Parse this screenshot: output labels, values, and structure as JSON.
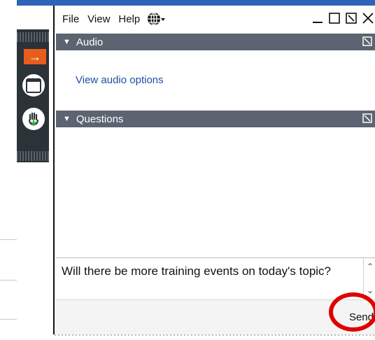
{
  "menubar": {
    "items": [
      "File",
      "View",
      "Help"
    ],
    "language_icon": "globe-icon",
    "controls": [
      "minimize-icon",
      "maximize-icon",
      "restore-icon",
      "close-icon"
    ]
  },
  "audio": {
    "title": "Audio",
    "link": "View audio options"
  },
  "questions": {
    "title": "Questions",
    "input_value": "Will there be more training events on today's topic?",
    "send_label": "Send"
  },
  "rail": {
    "icons": [
      "arrow-right-icon",
      "window-icon",
      "raise-hand-icon"
    ]
  },
  "colors": {
    "section_header": "#5b6470",
    "link": "#1d4f9e",
    "highlight": "#e00000",
    "rail_orange": "#e85d1c"
  }
}
